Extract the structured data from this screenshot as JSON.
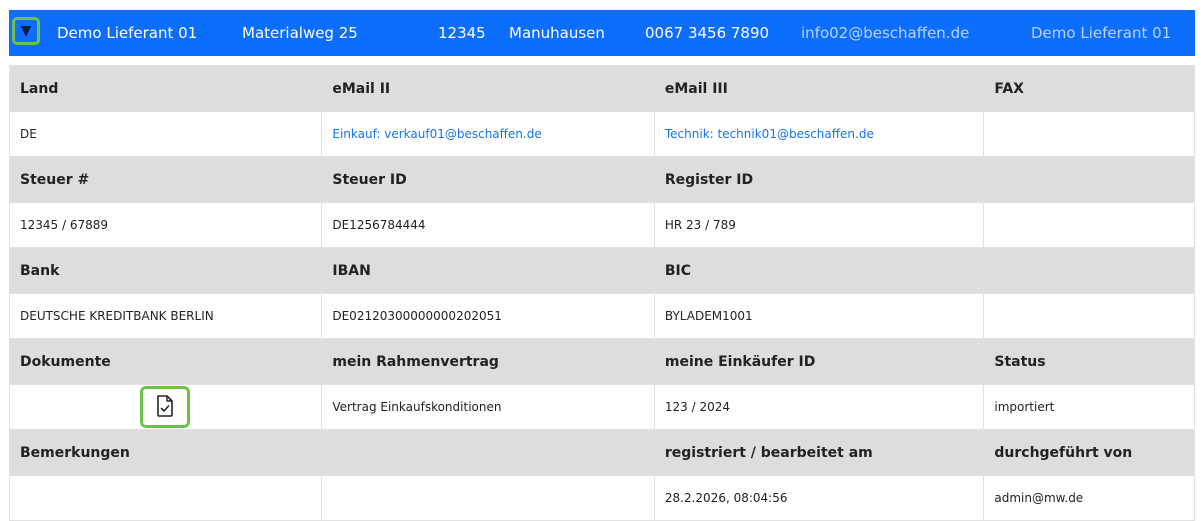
{
  "header": {
    "toggle_icon": "caret-down-icon",
    "name": "Demo Lieferant 01",
    "street": "Materialweg 25",
    "zip": "12345",
    "city": "Manuhausen",
    "phone": "0067 3456 7890",
    "email": "info02@beschaffen.de",
    "name2": "Demo Lieferant 01"
  },
  "rows": {
    "r1_head": [
      "Land",
      "eMail II",
      "eMail III",
      "FAX"
    ],
    "r1_val": [
      "DE",
      "Einkauf: verkauf01@beschaffen.de",
      "Technik: technik01@beschaffen.de",
      ""
    ],
    "r2_head": [
      "Steuer #",
      "Steuer ID",
      "Register ID",
      ""
    ],
    "r2_val": [
      "12345 / 67889",
      "DE1256784444",
      "HR 23 / 789",
      ""
    ],
    "r3_head": [
      "Bank",
      "IBAN",
      "BIC",
      ""
    ],
    "r3_val": [
      "DEUTSCHE KREDITBANK BERLIN",
      "DE02120300000000202051",
      "BYLADEM1001",
      ""
    ],
    "r4_head": [
      "Dokumente",
      "mein Rahmenvertrag",
      "meine Einkäufer ID",
      "Status"
    ],
    "r4_val": [
      "",
      "Vertrag Einkaufskonditionen",
      "123 / 2024",
      "importiert"
    ],
    "r5_head": [
      "Bemerkungen",
      "",
      "registriert / bearbeitet am",
      "durchgeführt von"
    ],
    "r5_val": [
      "",
      "",
      "28.2.2026, 08:04:56",
      "admin@mw.de"
    ]
  },
  "document_icon": "document-check-icon",
  "colors": {
    "header_bg": "#0d6efd",
    "highlight": "#6cc24a",
    "link": "#1a73e8"
  }
}
